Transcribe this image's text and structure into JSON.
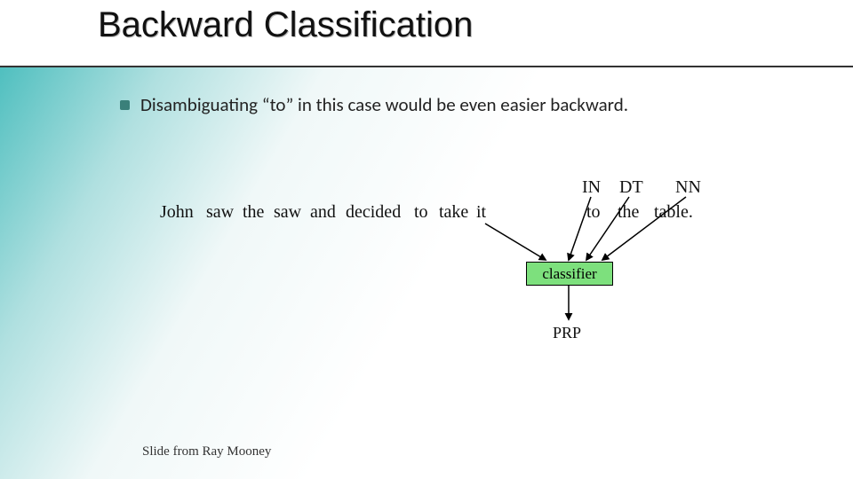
{
  "title": "Backward Classification",
  "bullet": "Disambiguating “to” in this case would be even easier backward.",
  "tags": {
    "in": "IN",
    "dt": "DT",
    "nn": "NN"
  },
  "words": {
    "john": "John",
    "saw1": "saw",
    "the1": "the",
    "saw2": "saw",
    "and": "and",
    "decided": "decided",
    "to1": "to",
    "take": "take",
    "it": "it",
    "to2": "to",
    "the2": "the",
    "table": "table."
  },
  "classifier": "classifier",
  "output_tag": "PRP",
  "footer": "Slide from Ray Mooney"
}
